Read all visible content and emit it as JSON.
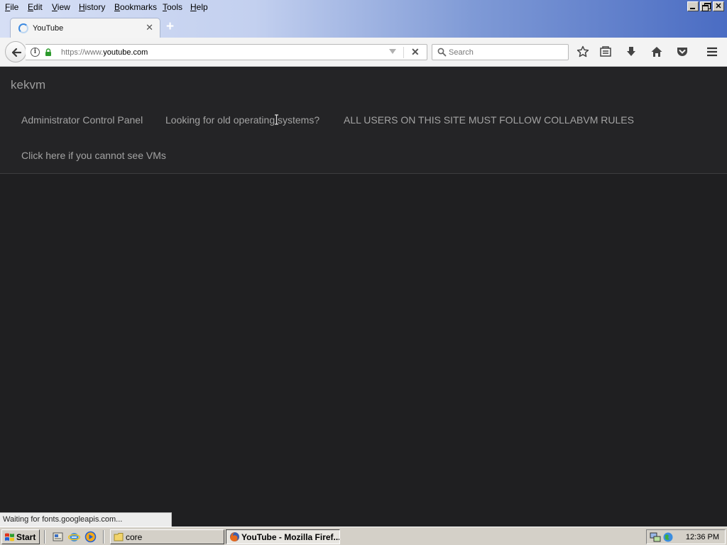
{
  "menubar": {
    "items": [
      "File",
      "Edit",
      "View",
      "History",
      "Bookmarks",
      "Tools",
      "Help"
    ]
  },
  "tab": {
    "title": "YouTube"
  },
  "navbar": {
    "url_prefix": "https://www.",
    "url_domain": "youtube.com",
    "search_placeholder": "Search"
  },
  "page": {
    "brand": "kekvm",
    "nav_links": [
      "Administrator Control Panel",
      "Looking for old operating systems?",
      "ALL USERS ON THIS SITE MUST FOLLOW COLLABVM RULES",
      "Click here if you cannot see VMs"
    ]
  },
  "status": {
    "text": "Waiting for fonts.googleapis.com..."
  },
  "taskbar": {
    "start_label": "Start",
    "tasks": [
      {
        "label": "core",
        "active": false
      },
      {
        "label": "YouTube - Mozilla Firef...",
        "active": true
      }
    ],
    "clock": "12:36 PM"
  },
  "colors": {
    "page_background": "#1f1f21",
    "header_background": "#242426",
    "link_text": "#a3a3a3",
    "brand_text": "#9c9c9c"
  }
}
